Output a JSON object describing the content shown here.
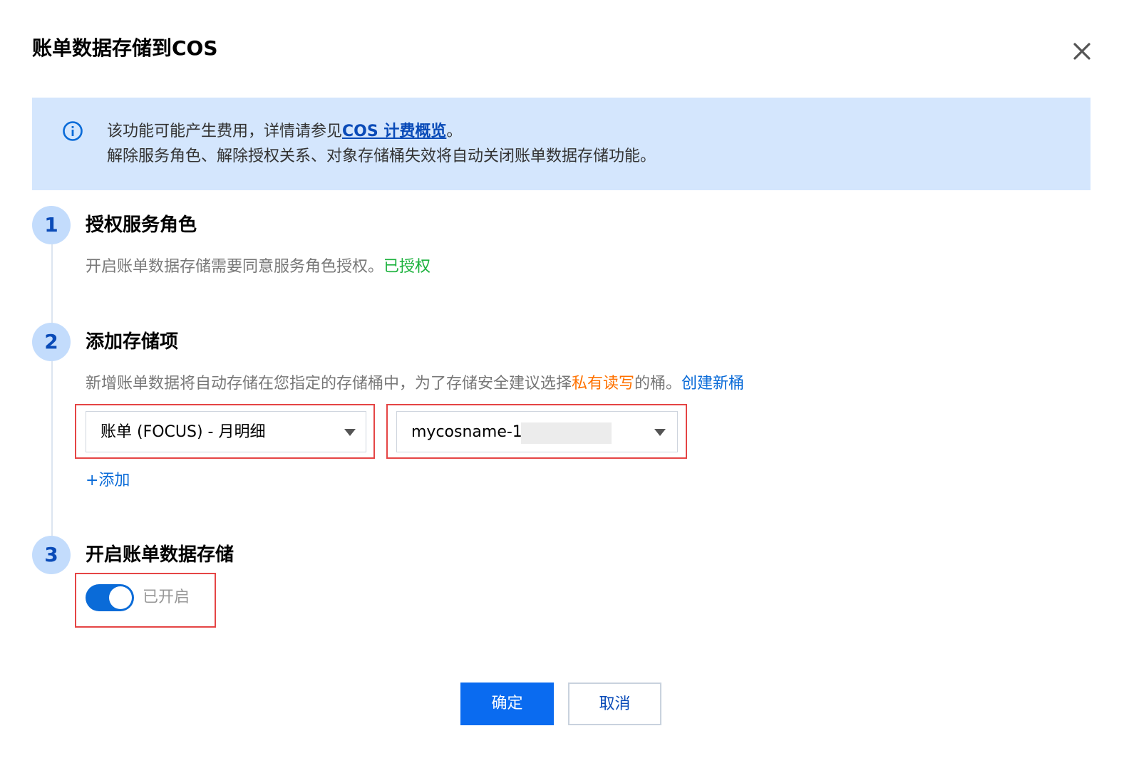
{
  "dialog": {
    "title": "账单数据存储到COS"
  },
  "notice": {
    "line1_text": "该功能可能产生费用，详情请参见",
    "line1_link": "COS 计费概览",
    "line1_end": "。",
    "line2": "解除服务角色、解除授权关系、对象存储桶失效将自动关闭账单数据存储功能。"
  },
  "steps": [
    {
      "number": "1",
      "title": "授权服务角色",
      "desc": "开启账单数据存储需要同意服务角色授权。",
      "status": "已授权"
    },
    {
      "number": "2",
      "title": "添加存储项",
      "desc_part1": "新增账单数据将自动存储在您指定的存储桶中，为了存储安全建议选择",
      "desc_highlight": "私有读写",
      "desc_part2": "的桶。",
      "create_link": "创建新桶",
      "bill_type_select": "账单 (FOCUS) - 月明细",
      "bucket_select": "mycosname-1",
      "add_link": "+添加"
    },
    {
      "number": "3",
      "title": "开启账单数据存储",
      "toggle_state": "已开启"
    }
  ],
  "buttons": {
    "confirm": "确定",
    "cancel": "取消"
  },
  "colors": {
    "primary": "#0a6bf0",
    "notice_bg": "#d4e6fd",
    "success": "#1cb23d",
    "warning": "#ff7200",
    "highlight_box": "#e54545"
  }
}
